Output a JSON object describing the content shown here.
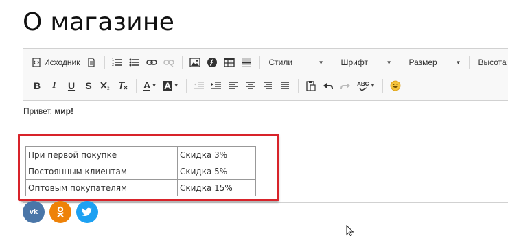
{
  "page": {
    "title": "О магазине"
  },
  "toolbar": {
    "source_label": "Исходник",
    "styles_label": "Стили",
    "font_label": "Шрифт",
    "size_label": "Размер",
    "height_label": "Высота",
    "bold_glyph": "B",
    "italic_glyph": "I",
    "underline_glyph": "U",
    "strike_glyph": "S",
    "text_color_glyph": "A",
    "bg_color_glyph": "A",
    "spell_glyph": "ABC"
  },
  "content": {
    "greeting_plain": "Привет, ",
    "greeting_bold": "мир!"
  },
  "table": {
    "rows": [
      {
        "label": "При первой покупке",
        "discount": "Скидка 3%"
      },
      {
        "label": "Постоянным клиентам",
        "discount": "Скидка 5%"
      },
      {
        "label": "Оптовым покупателям",
        "discount": "Скидка 15%"
      }
    ]
  },
  "social": {
    "vk_glyph": "vk",
    "ok_glyph": "ok",
    "tw_glyph": "tw"
  },
  "colors": {
    "highlight": "#d8232a",
    "vk": "#4a76a8",
    "ok": "#ee8208",
    "twitter": "#1da1f2"
  }
}
